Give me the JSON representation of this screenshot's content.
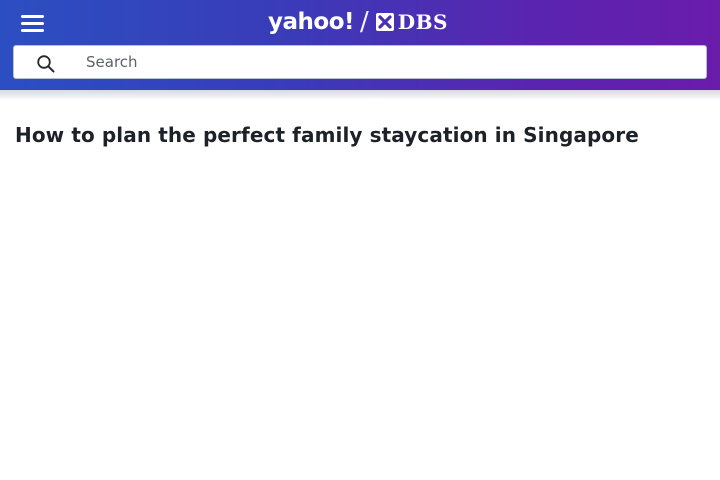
{
  "header": {
    "logo_primary": "yahoo!",
    "logo_divider": "/",
    "logo_partner": "DBS",
    "gradient_colors": [
      "#2b4fc2",
      "#3a3bb8",
      "#5a24b0",
      "#6a1cab"
    ],
    "menu_icon": "hamburger-menu-icon"
  },
  "search": {
    "placeholder": "Search",
    "value": "",
    "icon": "search-icon"
  },
  "article": {
    "title": "How to plan the perfect family staycation in Singapore",
    "title_color": "#1d2228"
  }
}
